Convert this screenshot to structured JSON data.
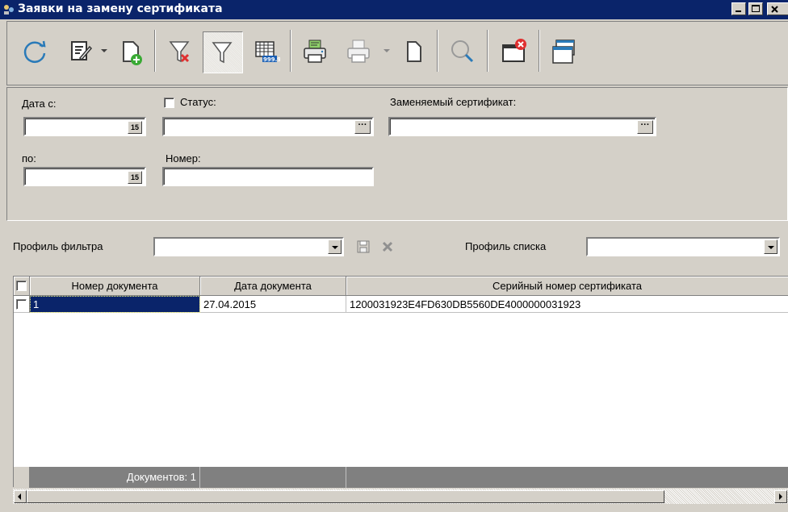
{
  "window": {
    "title": "Заявки на замену сертификата",
    "controls": [
      "minimize",
      "maximize",
      "close"
    ]
  },
  "toolbar": {
    "buttons": [
      {
        "icon": "refresh-icon"
      },
      {
        "icon": "edit-icon",
        "has_dropdown": true
      },
      {
        "icon": "new-document-icon"
      },
      {
        "icon": "clear-filter-icon"
      },
      {
        "icon": "filter-icon",
        "pressed": true
      },
      {
        "icon": "table-totals-icon"
      },
      {
        "icon": "print-icon"
      },
      {
        "icon": "print-preview-icon",
        "has_dropdown": true
      },
      {
        "icon": "copy-document-icon"
      },
      {
        "icon": "search-icon"
      },
      {
        "icon": "close-window-icon"
      },
      {
        "icon": "cascade-windows-icon"
      }
    ]
  },
  "filter": {
    "date_from_label": "Дата с:",
    "date_from_value": "",
    "date_to_label": "по:",
    "date_to_value": "",
    "status_label": "Статус:",
    "status_checked": false,
    "status_value": "",
    "number_label": "Номер:",
    "number_value": "",
    "replaced_cert_label": "Заменяемый сертификат:",
    "replaced_cert_value": "",
    "calendar_glyph": "15",
    "ellipsis_glyph": "···"
  },
  "profiles": {
    "filter_profile_label": "Профиль фильтра",
    "filter_profile_value": "",
    "list_profile_label": "Профиль списка",
    "list_profile_value": ""
  },
  "grid": {
    "columns": [
      "Номер документа",
      "Дата документа",
      "Серийный номер сертификата"
    ],
    "rows": [
      {
        "number": "1",
        "date": "27.04.2015",
        "serial": "1200031923E4FD630DB5560DE4000000031923",
        "checked": false,
        "selected": true
      }
    ],
    "footer": "Документов: 1"
  },
  "colors": {
    "titlebar": "#0a246a",
    "chrome": "#d4d0c8",
    "selection": "#0a246a",
    "accent_blue": "#2a7ab8"
  }
}
